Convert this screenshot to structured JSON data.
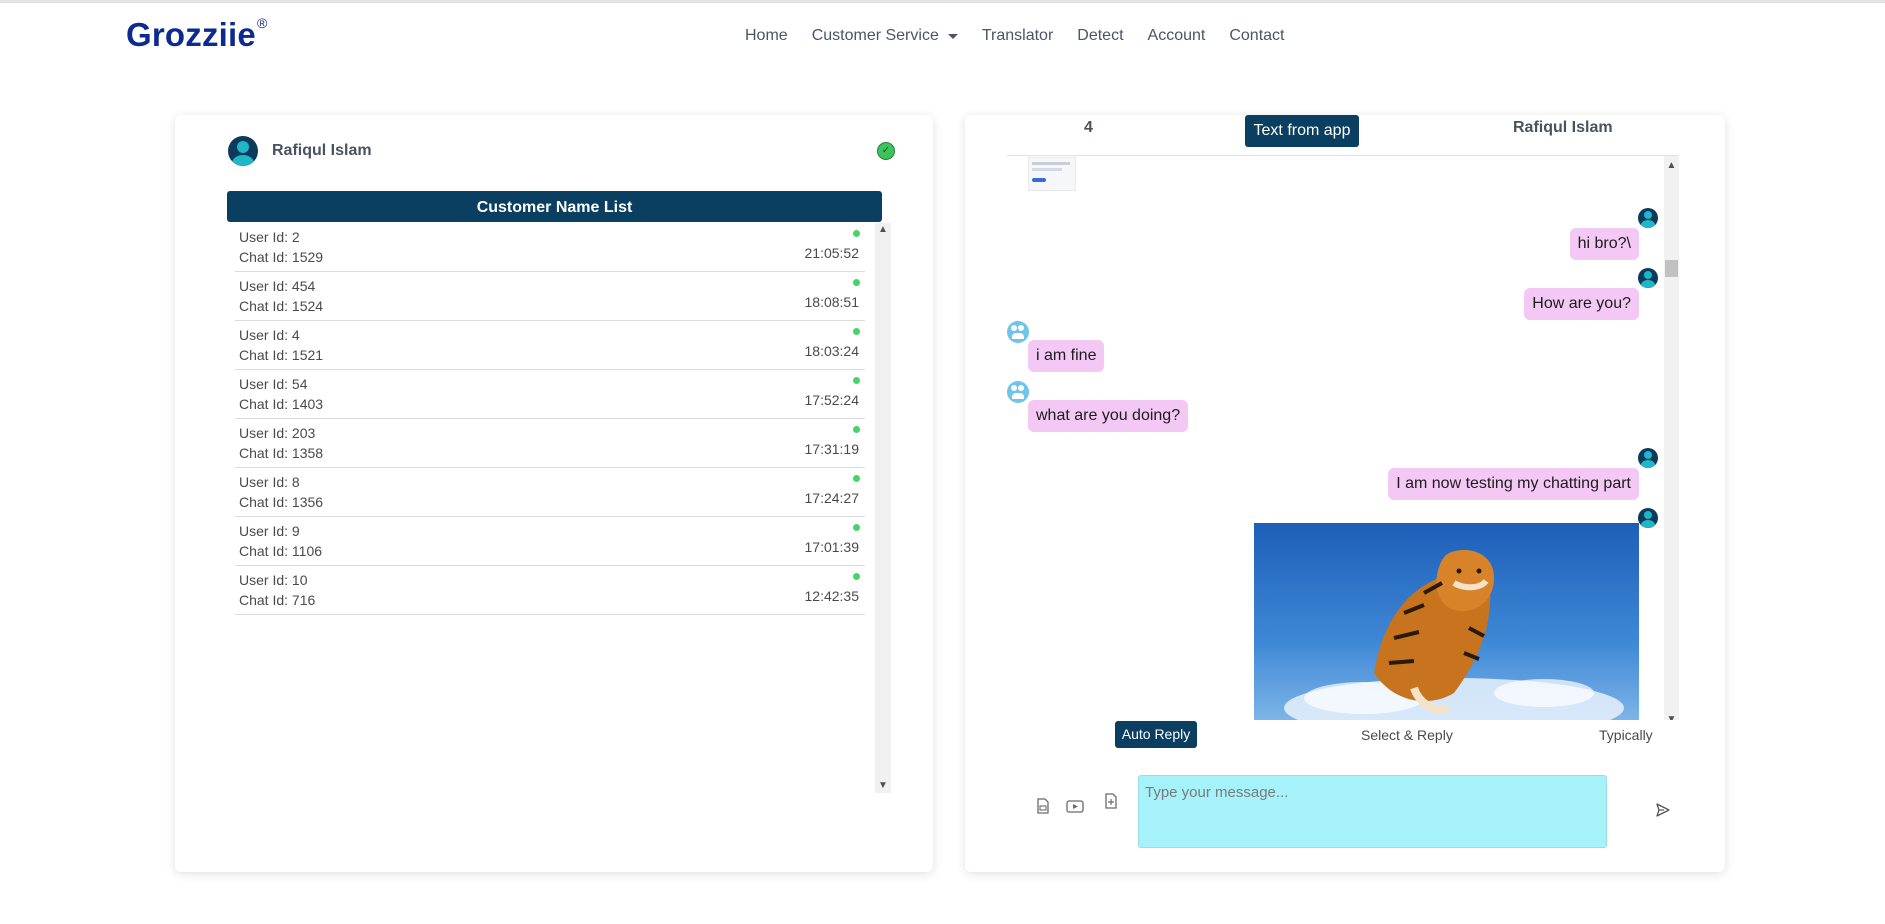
{
  "brand": {
    "name": "Grozziie",
    "mark": "®"
  },
  "nav": {
    "items": [
      {
        "label": "Home"
      },
      {
        "label": "Customer Service"
      },
      {
        "label": "Translator"
      },
      {
        "label": "Detect"
      },
      {
        "label": "Account"
      },
      {
        "label": "Contact"
      }
    ]
  },
  "left_panel": {
    "agent_name": "Rafiqul Islam",
    "list_title": "Customer Name List",
    "customers": [
      {
        "user": "User Id: 2",
        "chat": "Chat Id: 1529",
        "time": "21:05:52"
      },
      {
        "user": "User Id: 454",
        "chat": "Chat Id: 1524",
        "time": "18:08:51"
      },
      {
        "user": "User Id: 4",
        "chat": "Chat Id: 1521",
        "time": "18:03:24"
      },
      {
        "user": "User Id: 54",
        "chat": "Chat Id: 1403",
        "time": "17:52:24"
      },
      {
        "user": "User Id: 203",
        "chat": "Chat Id: 1358",
        "time": "17:31:19"
      },
      {
        "user": "User Id: 8",
        "chat": "Chat Id: 1356",
        "time": "17:24:27"
      },
      {
        "user": "User Id: 9",
        "chat": "Chat Id: 1106",
        "time": "17:01:39"
      },
      {
        "user": "User Id: 10",
        "chat": "Chat Id: 716",
        "time": "12:42:35"
      }
    ]
  },
  "right_panel": {
    "user_id": "4",
    "source_label": "Text from app",
    "agent_name": "Rafiqul Islam",
    "messages": [
      {
        "text": "hi bro?\\",
        "dir": "out"
      },
      {
        "text": "How are you?",
        "dir": "out"
      },
      {
        "text": "i am fine",
        "dir": "in"
      },
      {
        "text": "what are you doing?",
        "dir": "in"
      },
      {
        "text": "I am now testing my chatting part",
        "dir": "out"
      }
    ],
    "reply_modes": {
      "auto": "Auto Reply",
      "select": "Select & Reply",
      "typically": "Typically"
    },
    "composer": {
      "placeholder": "Type your message..."
    }
  },
  "colors": {
    "brand": "#0d2b8e",
    "primary": "#0b3f62",
    "bubble": "#f4c8f4",
    "input_bg": "#a6f2fb",
    "online": "#45d46a"
  }
}
